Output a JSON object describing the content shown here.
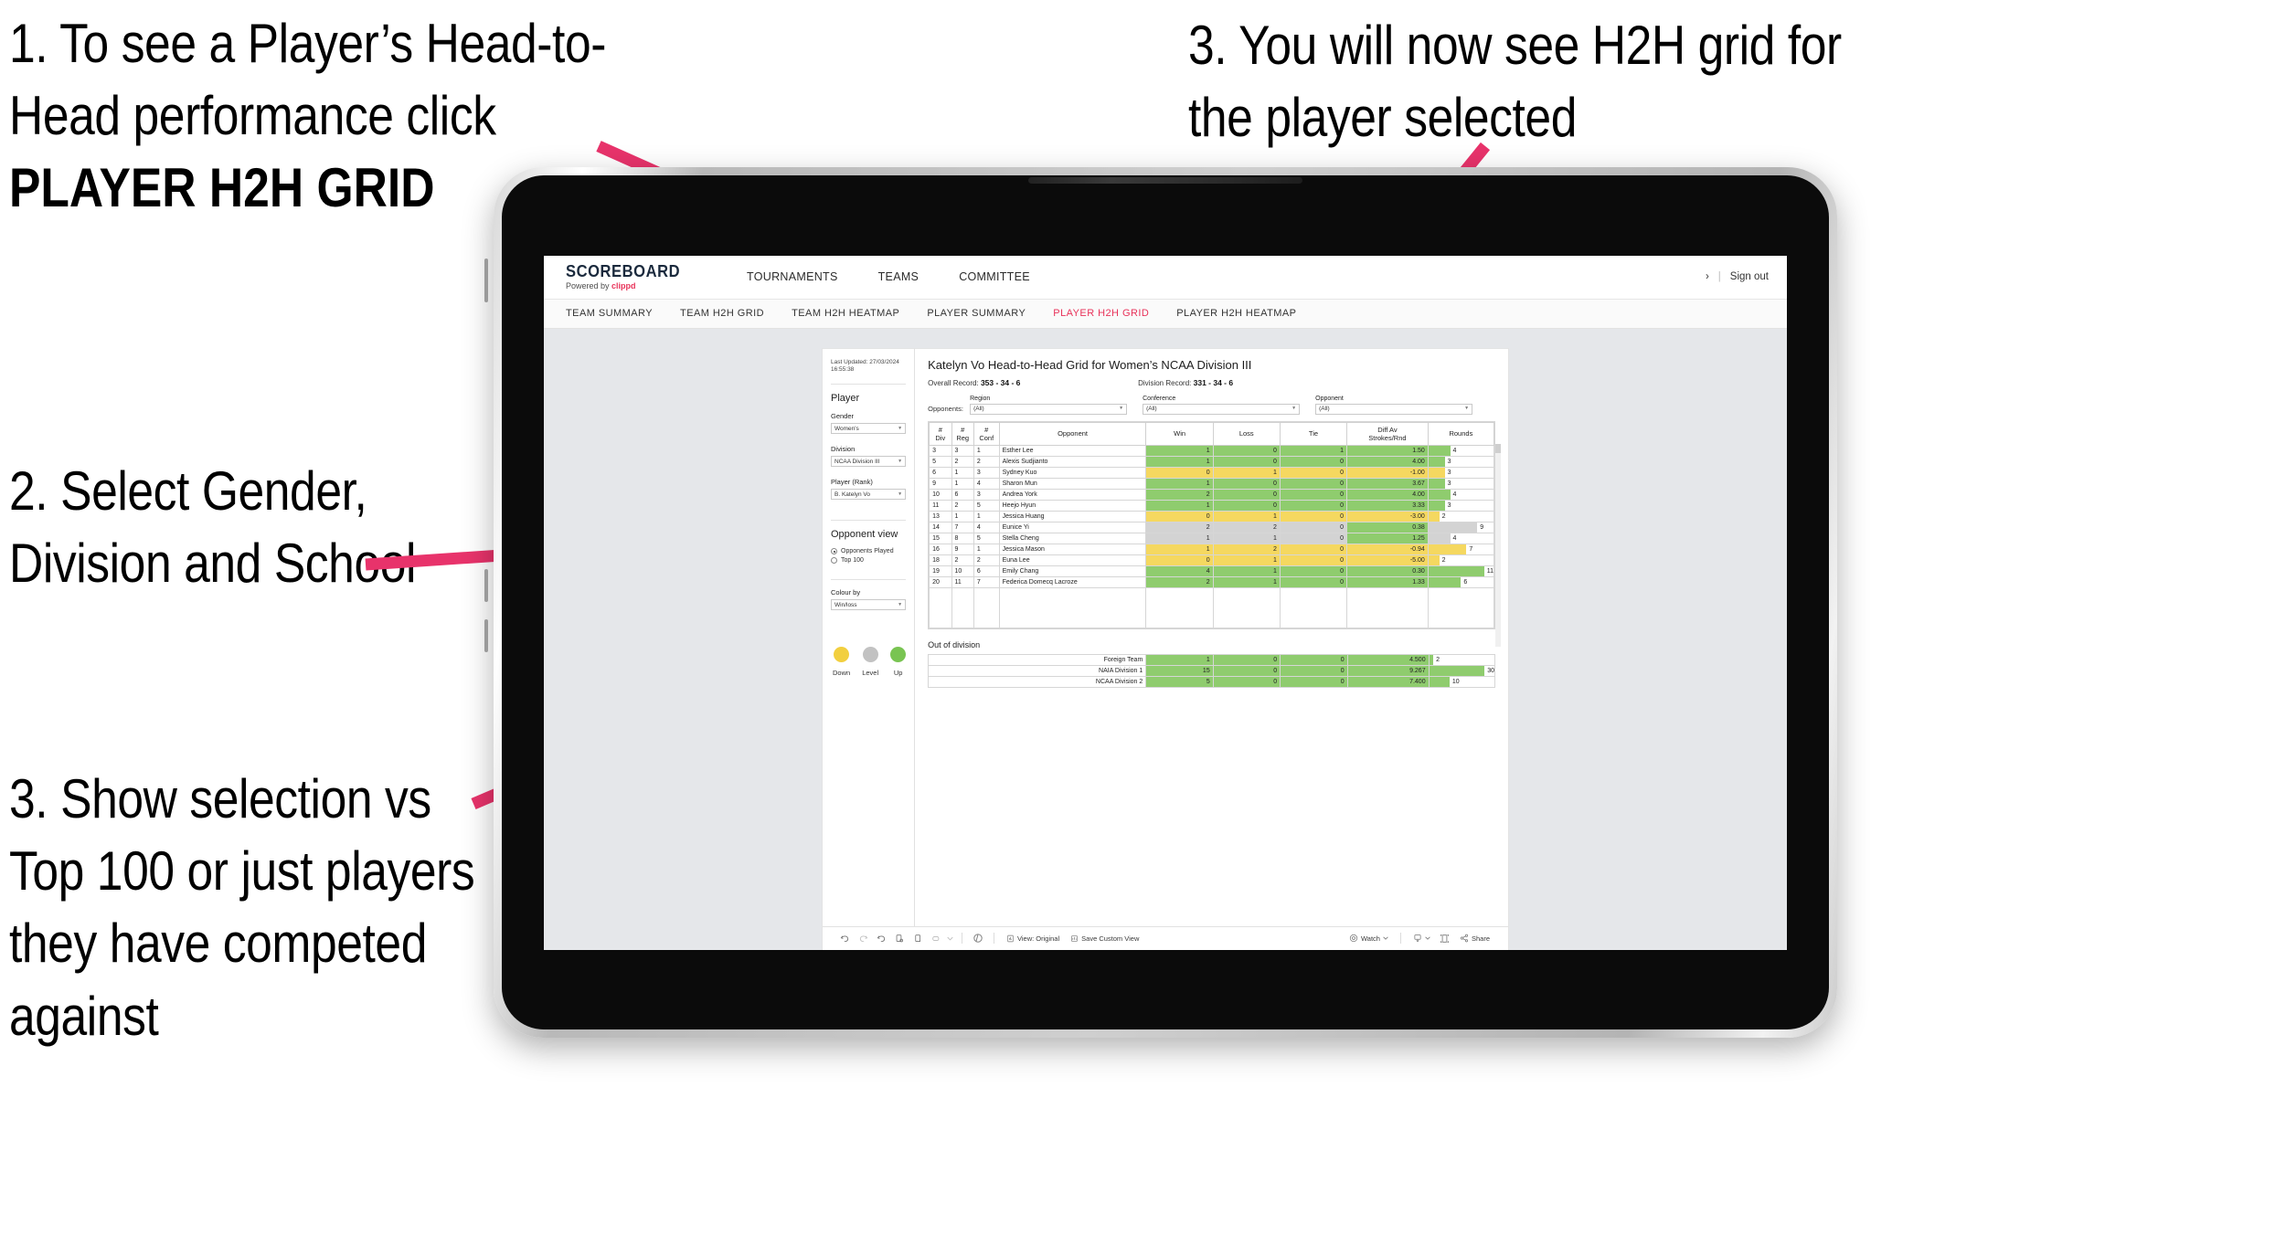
{
  "annotations": [
    {
      "id": "a1",
      "text_before": "1. To see a Player’s Head-to-Head performance click ",
      "bold": "PLAYER H2H GRID"
    },
    {
      "id": "a2",
      "text": "2. Select Gender, Division and School"
    },
    {
      "id": "a3",
      "text": "3. Show selection vs Top 100 or just players they have competed against"
    },
    {
      "id": "a4",
      "text": "3. You will now see H2H grid for the player selected"
    }
  ],
  "colors": {
    "accent": "#e8335a",
    "green": "#8fcc6e",
    "yellow": "#f5d860",
    "grey": "#d3d3d3",
    "legend_down": "#f2cf3f",
    "legend_level": "#c2c2c2",
    "legend_up": "#79c452"
  },
  "app": {
    "brand": {
      "name": "SCOREBOARD",
      "powered_prefix": "Powered by ",
      "powered_brand": "clippd"
    },
    "top_nav": [
      "TOURNAMENTS",
      "TEAMS",
      "COMMITTEE"
    ],
    "top_right": {
      "chevron": "›",
      "separator": "|",
      "sign_out": "Sign out"
    },
    "sub_nav": [
      {
        "label": "TEAM SUMMARY",
        "active": false
      },
      {
        "label": "TEAM H2H GRID",
        "active": false
      },
      {
        "label": "TEAM H2H HEATMAP",
        "active": false
      },
      {
        "label": "PLAYER SUMMARY",
        "active": false
      },
      {
        "label": "PLAYER H2H GRID",
        "active": true
      },
      {
        "label": "PLAYER H2H HEATMAP",
        "active": false
      }
    ]
  },
  "filters": {
    "last_updated": "Last Updated: 27/03/2024 16:55:38",
    "player_heading": "Player",
    "gender": {
      "label": "Gender",
      "value": "Women's"
    },
    "division": {
      "label": "Division",
      "value": "NCAA Division III"
    },
    "player_rank": {
      "label": "Player (Rank)",
      "value": "B. Katelyn Vo"
    },
    "opponent_view": {
      "heading": "Opponent view",
      "options": [
        {
          "label": "Opponents Played",
          "selected": true
        },
        {
          "label": "Top 100",
          "selected": false
        }
      ]
    },
    "colour_by": {
      "label": "Colour by",
      "value": "Win/loss"
    },
    "legend": [
      {
        "label": "Down",
        "color": "#f2cf3f"
      },
      {
        "label": "Level",
        "color": "#c2c2c2"
      },
      {
        "label": "Up",
        "color": "#79c452"
      }
    ]
  },
  "report": {
    "title": "Katelyn Vo Head-to-Head Grid for Women’s NCAA Division III",
    "overall_record_label": "Overall Record:",
    "overall_record_value": "353 - 34 - 6",
    "division_record_label": "Division Record:",
    "division_record_value": "331 - 34 - 6",
    "opponents_label": "Opponents:",
    "opponent_filters": [
      {
        "label": "Region",
        "value": "(All)"
      },
      {
        "label": "Conference",
        "value": "(All)"
      },
      {
        "label": "Opponent",
        "value": "(All)"
      }
    ],
    "out_of_division_title": "Out of division"
  },
  "chart_data": {
    "type": "table",
    "title": "Katelyn Vo Head-to-Head Grid for Women’s NCAA Division III",
    "columns": [
      "# Div",
      "# Reg",
      "# Conf",
      "Opponent",
      "Win",
      "Loss",
      "Tie",
      "Diff Av Strokes/Rnd",
      "Rounds"
    ],
    "column_headers_two_line": [
      [
        "#",
        "Div"
      ],
      [
        "#",
        "Reg"
      ],
      [
        "#",
        "Conf"
      ],
      [
        "Opponent",
        ""
      ],
      [
        "Win",
        ""
      ],
      [
        "Loss",
        ""
      ],
      [
        "Tie",
        ""
      ],
      [
        "Diff Av",
        "Strokes/Rnd"
      ],
      [
        "Rounds",
        ""
      ]
    ],
    "rounds_max": 12,
    "rows": [
      {
        "div": "3",
        "reg": "3",
        "conf": "1",
        "opponent": "Esther Lee",
        "win": "1",
        "loss": "0",
        "tie": "1",
        "diff": "1.50",
        "rounds": "4",
        "state": "g"
      },
      {
        "div": "5",
        "reg": "2",
        "conf": "2",
        "opponent": "Alexis Sudjianto",
        "win": "1",
        "loss": "0",
        "tie": "0",
        "diff": "4.00",
        "rounds": "3",
        "state": "g"
      },
      {
        "div": "6",
        "reg": "1",
        "conf": "3",
        "opponent": "Sydney Kuo",
        "win": "0",
        "loss": "1",
        "tie": "0",
        "diff": "-1.00",
        "rounds": "3",
        "state": "y"
      },
      {
        "div": "9",
        "reg": "1",
        "conf": "4",
        "opponent": "Sharon Mun",
        "win": "1",
        "loss": "0",
        "tie": "0",
        "diff": "3.67",
        "rounds": "3",
        "state": "g"
      },
      {
        "div": "10",
        "reg": "6",
        "conf": "3",
        "opponent": "Andrea York",
        "win": "2",
        "loss": "0",
        "tie": "0",
        "diff": "4.00",
        "rounds": "4",
        "state": "g"
      },
      {
        "div": "11",
        "reg": "2",
        "conf": "5",
        "opponent": "Heejo Hyun",
        "win": "1",
        "loss": "0",
        "tie": "0",
        "diff": "3.33",
        "rounds": "3",
        "state": "g"
      },
      {
        "div": "13",
        "reg": "1",
        "conf": "1",
        "opponent": "Jessica Huang",
        "win": "0",
        "loss": "1",
        "tie": "0",
        "diff": "-3.00",
        "rounds": "2",
        "state": "y"
      },
      {
        "div": "14",
        "reg": "7",
        "conf": "4",
        "opponent": "Eunice Yi",
        "win": "2",
        "loss": "2",
        "tie": "0",
        "diff": "0.38",
        "rounds": "9",
        "state": "n",
        "diff_state": "g"
      },
      {
        "div": "15",
        "reg": "8",
        "conf": "5",
        "opponent": "Stella Cheng",
        "win": "1",
        "loss": "1",
        "tie": "0",
        "diff": "1.25",
        "rounds": "4",
        "state": "n",
        "diff_state": "g"
      },
      {
        "div": "16",
        "reg": "9",
        "conf": "1",
        "opponent": "Jessica Mason",
        "win": "1",
        "loss": "2",
        "tie": "0",
        "diff": "-0.94",
        "rounds": "7",
        "state": "y"
      },
      {
        "div": "18",
        "reg": "2",
        "conf": "2",
        "opponent": "Euna Lee",
        "win": "0",
        "loss": "1",
        "tie": "0",
        "diff": "-5.00",
        "rounds": "2",
        "state": "y"
      },
      {
        "div": "19",
        "reg": "10",
        "conf": "6",
        "opponent": "Emily Chang",
        "win": "4",
        "loss": "1",
        "tie": "0",
        "diff": "0.30",
        "rounds": "11",
        "state": "g"
      },
      {
        "div": "20",
        "reg": "11",
        "conf": "7",
        "opponent": "Federica Domecq Lacroze",
        "win": "2",
        "loss": "1",
        "tie": "0",
        "diff": "1.33",
        "rounds": "6",
        "state": "g"
      }
    ],
    "out_of_division": {
      "rounds_max": 32,
      "rows": [
        {
          "name": "Foreign Team",
          "win": "1",
          "loss": "0",
          "tie": "0",
          "diff": "4.500",
          "rounds": "2",
          "state": "g"
        },
        {
          "name": "NAIA Division 1",
          "win": "15",
          "loss": "0",
          "tie": "0",
          "diff": "9.267",
          "rounds": "30",
          "state": "g"
        },
        {
          "name": "NCAA Division 2",
          "win": "5",
          "loss": "0",
          "tie": "0",
          "diff": "7.400",
          "rounds": "10",
          "state": "g"
        }
      ]
    }
  },
  "toolbar": {
    "view_label": "View: Original",
    "save_custom_view_label": "Save Custom View",
    "watch_label": "Watch",
    "share_label": "Share"
  }
}
